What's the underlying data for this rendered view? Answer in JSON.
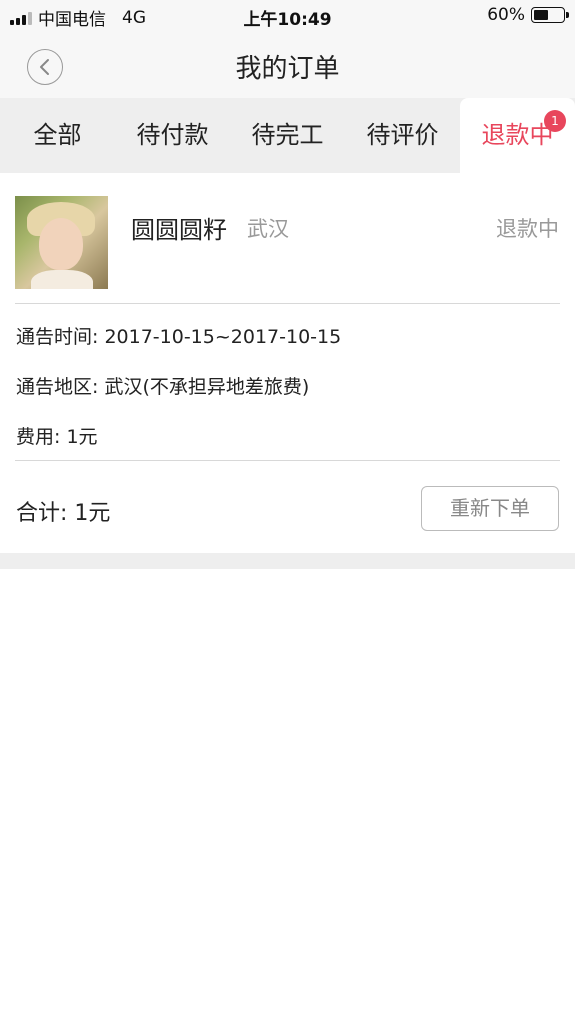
{
  "status_bar": {
    "carrier": "中国电信",
    "network": "4G",
    "time": "上午10:49",
    "battery": "60%",
    "battery_level": 0.6
  },
  "header": {
    "title": "我的订单"
  },
  "tabs": [
    {
      "label": "全部"
    },
    {
      "label": "待付款"
    },
    {
      "label": "待完工"
    },
    {
      "label": "待评价"
    },
    {
      "label": "退款中",
      "badge": "1",
      "active": true
    }
  ],
  "order": {
    "model_name": "圆圆圆籽",
    "city": "武汉",
    "status": "退款中",
    "time_label": "通告时间: 2017-10-15~2017-10-15",
    "location_label": "通告地区: 武汉(不承担异地差旅费)",
    "fee_label": "费用: 1元",
    "total_label": "合计: 1元",
    "reorder_button": "重新下单"
  },
  "colors": {
    "accent": "#e8465c",
    "background": "#eeeeee"
  }
}
